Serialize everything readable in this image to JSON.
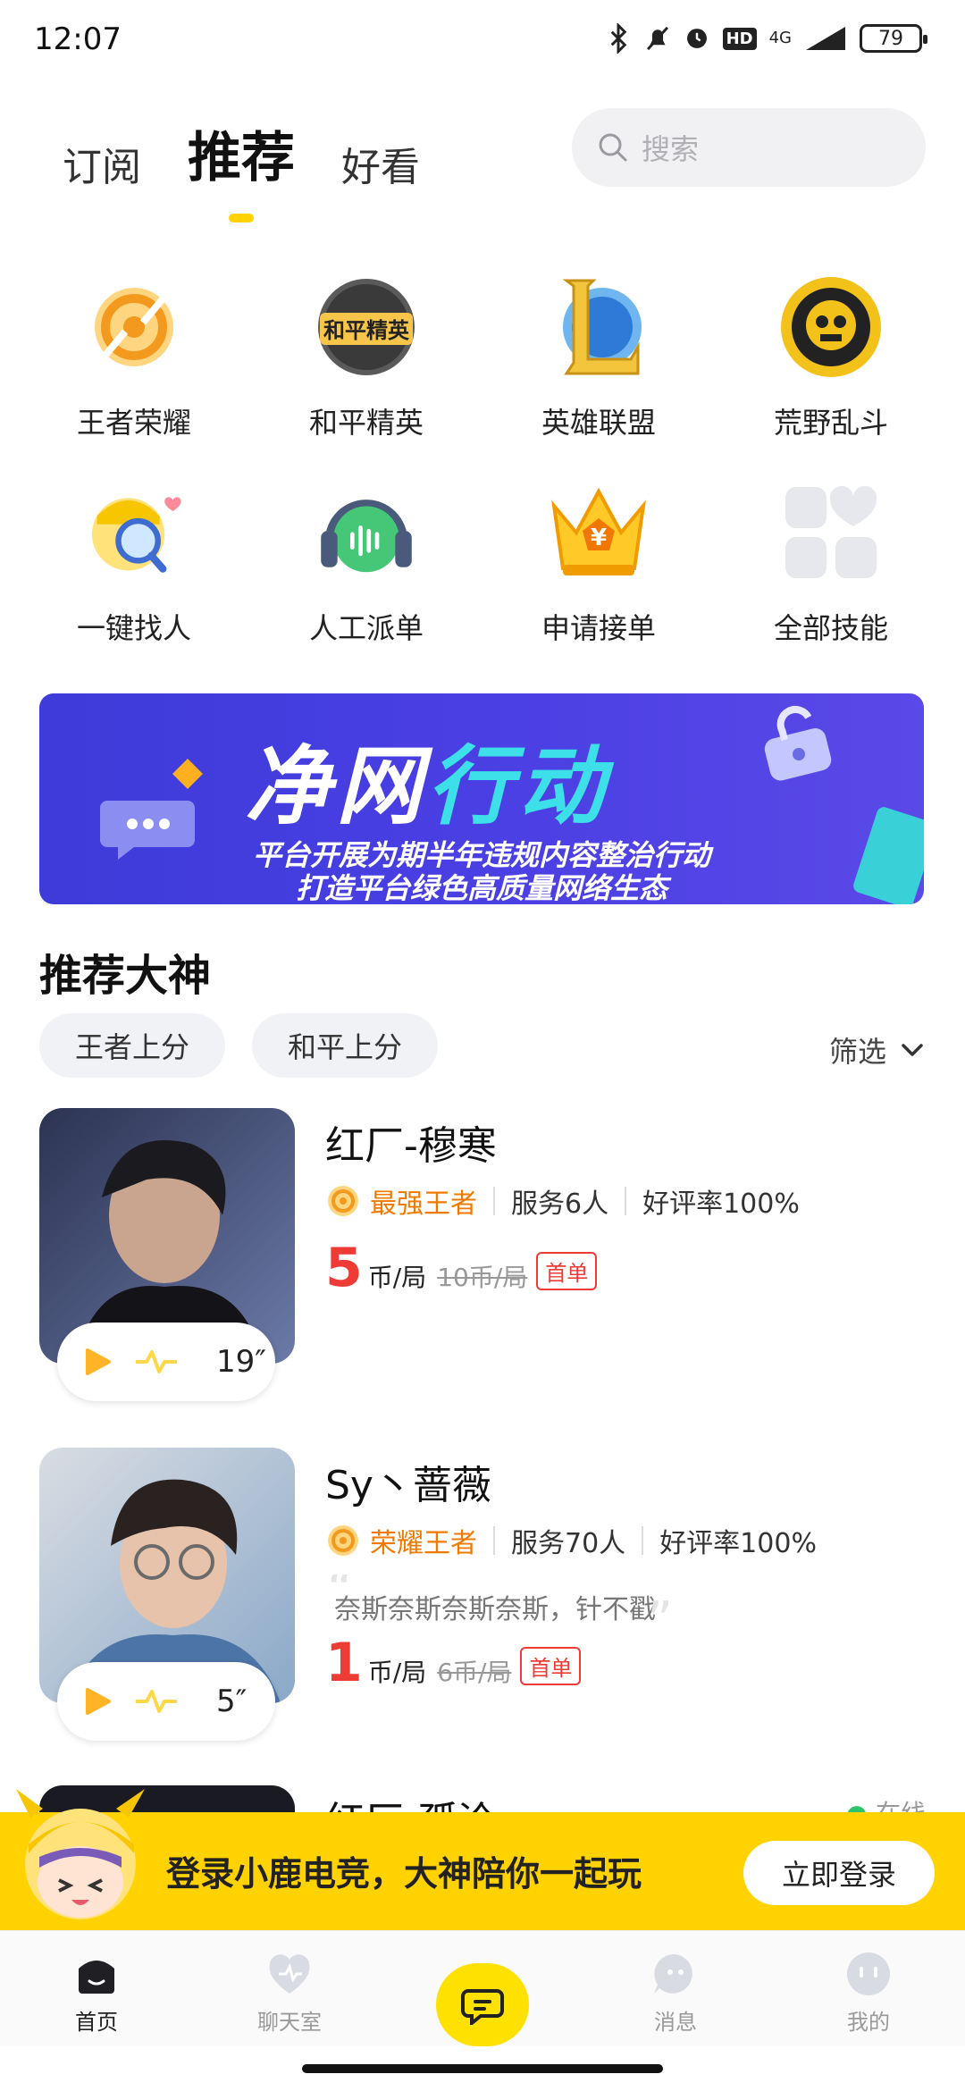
{
  "status_bar": {
    "time": "12:07",
    "network": "4G",
    "hd": "HD",
    "battery": "79"
  },
  "tabs": [
    {
      "label": "订阅"
    },
    {
      "label": "推荐"
    },
    {
      "label": "好看"
    }
  ],
  "search": {
    "placeholder": "搜索"
  },
  "games": [
    {
      "label": "王者荣耀"
    },
    {
      "label": "和平精英",
      "icon_text": "和平精英"
    },
    {
      "label": "英雄联盟"
    },
    {
      "label": "荒野乱斗"
    },
    {
      "label": "一键找人"
    },
    {
      "label": "人工派单"
    },
    {
      "label": "申请接单"
    },
    {
      "label": "全部技能"
    }
  ],
  "banner": {
    "title_white": "净网",
    "title_cyan": "行动",
    "line1": "平台开展为期半年违规内容整治行动",
    "line2": "打造平台绿色高质量网络生态"
  },
  "section": {
    "title": "推荐大神",
    "chips": [
      "王者上分",
      "和平上分"
    ],
    "filter": "筛选"
  },
  "cards": [
    {
      "name": "红厂-穆寒",
      "rank": "最强王者",
      "served": "服务6人",
      "rating": "好评率100%",
      "price": "5",
      "unit": "币/局",
      "original": "10币/局",
      "badge": "首单",
      "voice_duration": "19″",
      "quote": ""
    },
    {
      "name": "Sy丶蔷薇",
      "rank": "荣耀王者",
      "served": "服务70人",
      "rating": "好评率100%",
      "price": "1",
      "unit": "币/局",
      "original": "6币/局",
      "badge": "首单",
      "voice_duration": "5″",
      "quote": "奈斯奈斯奈斯奈斯，针不戳"
    }
  ],
  "partial_card": {
    "name": "红厂-孤泠",
    "status": "在线"
  },
  "login_bar": {
    "text": "登录小鹿电竞，大神陪你一起玩",
    "button": "立即登录"
  },
  "bottom_nav": [
    {
      "label": "首页"
    },
    {
      "label": "聊天室"
    },
    {
      "label": ""
    },
    {
      "label": "消息"
    },
    {
      "label": "我的"
    }
  ],
  "colors": {
    "accent": "#FFD200",
    "price": "#EF3B36",
    "rank": "#F07A00",
    "banner": "#4A3FE3"
  }
}
